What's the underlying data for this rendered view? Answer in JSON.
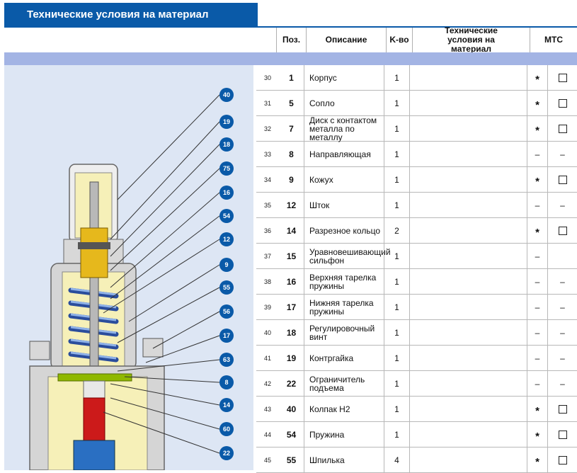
{
  "title": "Технические условия на материал",
  "headers": {
    "pos": "Поз.",
    "desc": "Описание",
    "qty": "K-во",
    "tech": "Технические условия на материал",
    "mtc": "МТС"
  },
  "rows": [
    {
      "n": "30",
      "pos": "1",
      "desc": "Корпус",
      "qty": "1",
      "m1": "*",
      "m2": "box"
    },
    {
      "n": "31",
      "pos": "5",
      "desc": "Сопло",
      "qty": "1",
      "m1": "*",
      "m2": "box"
    },
    {
      "n": "32",
      "pos": "7",
      "desc": "Диск с контактом металла по металлу",
      "qty": "1",
      "m1": "*",
      "m2": "box"
    },
    {
      "n": "33",
      "pos": "8",
      "desc": "Направляющая",
      "qty": "1",
      "m1": "–",
      "m2": "–"
    },
    {
      "n": "34",
      "pos": "9",
      "desc": "Кожух",
      "qty": "1",
      "m1": "*",
      "m2": "box"
    },
    {
      "n": "35",
      "pos": "12",
      "desc": "Шток",
      "qty": "1",
      "m1": "–",
      "m2": "–"
    },
    {
      "n": "36",
      "pos": "14",
      "desc": "Разрезное кольцо",
      "qty": "2",
      "m1": "*",
      "m2": "box"
    },
    {
      "n": "37",
      "pos": "15",
      "desc": "Уравновешивающий сильфон",
      "qty": "1",
      "m1": "–",
      "m2": ""
    },
    {
      "n": "38",
      "pos": "16",
      "desc": "Верхняя тарелка пружины",
      "qty": "1",
      "m1": "–",
      "m2": "–"
    },
    {
      "n": "39",
      "pos": "17",
      "desc": "Нижняя тарелка пружины",
      "qty": "1",
      "m1": "–",
      "m2": "–"
    },
    {
      "n": "40",
      "pos": "18",
      "desc": "Регулировочный винт",
      "qty": "1",
      "m1": "–",
      "m2": "–"
    },
    {
      "n": "41",
      "pos": "19",
      "desc": "Контргайка",
      "qty": "1",
      "m1": "–",
      "m2": "–"
    },
    {
      "n": "42",
      "pos": "22",
      "desc": "Ограничитель подъема",
      "qty": "1",
      "m1": "–",
      "m2": "–"
    },
    {
      "n": "43",
      "pos": "40",
      "desc": "Колпак H2",
      "qty": "1",
      "m1": "*",
      "m2": "box"
    },
    {
      "n": "44",
      "pos": "54",
      "desc": "Пружина",
      "qty": "1",
      "m1": "*",
      "m2": "box"
    },
    {
      "n": "45",
      "pos": "55",
      "desc": "Шпилька",
      "qty": "4",
      "m1": "*",
      "m2": "box"
    }
  ],
  "callouts": [
    "40",
    "19",
    "18",
    "75",
    "16",
    "54",
    "12",
    "9",
    "55",
    "56",
    "17",
    "63",
    "8",
    "14",
    "60",
    "22"
  ],
  "colors": {
    "brand": "#0a5aa8",
    "band": "#a3b4e4",
    "illustration_bg": "#dde6f4"
  }
}
